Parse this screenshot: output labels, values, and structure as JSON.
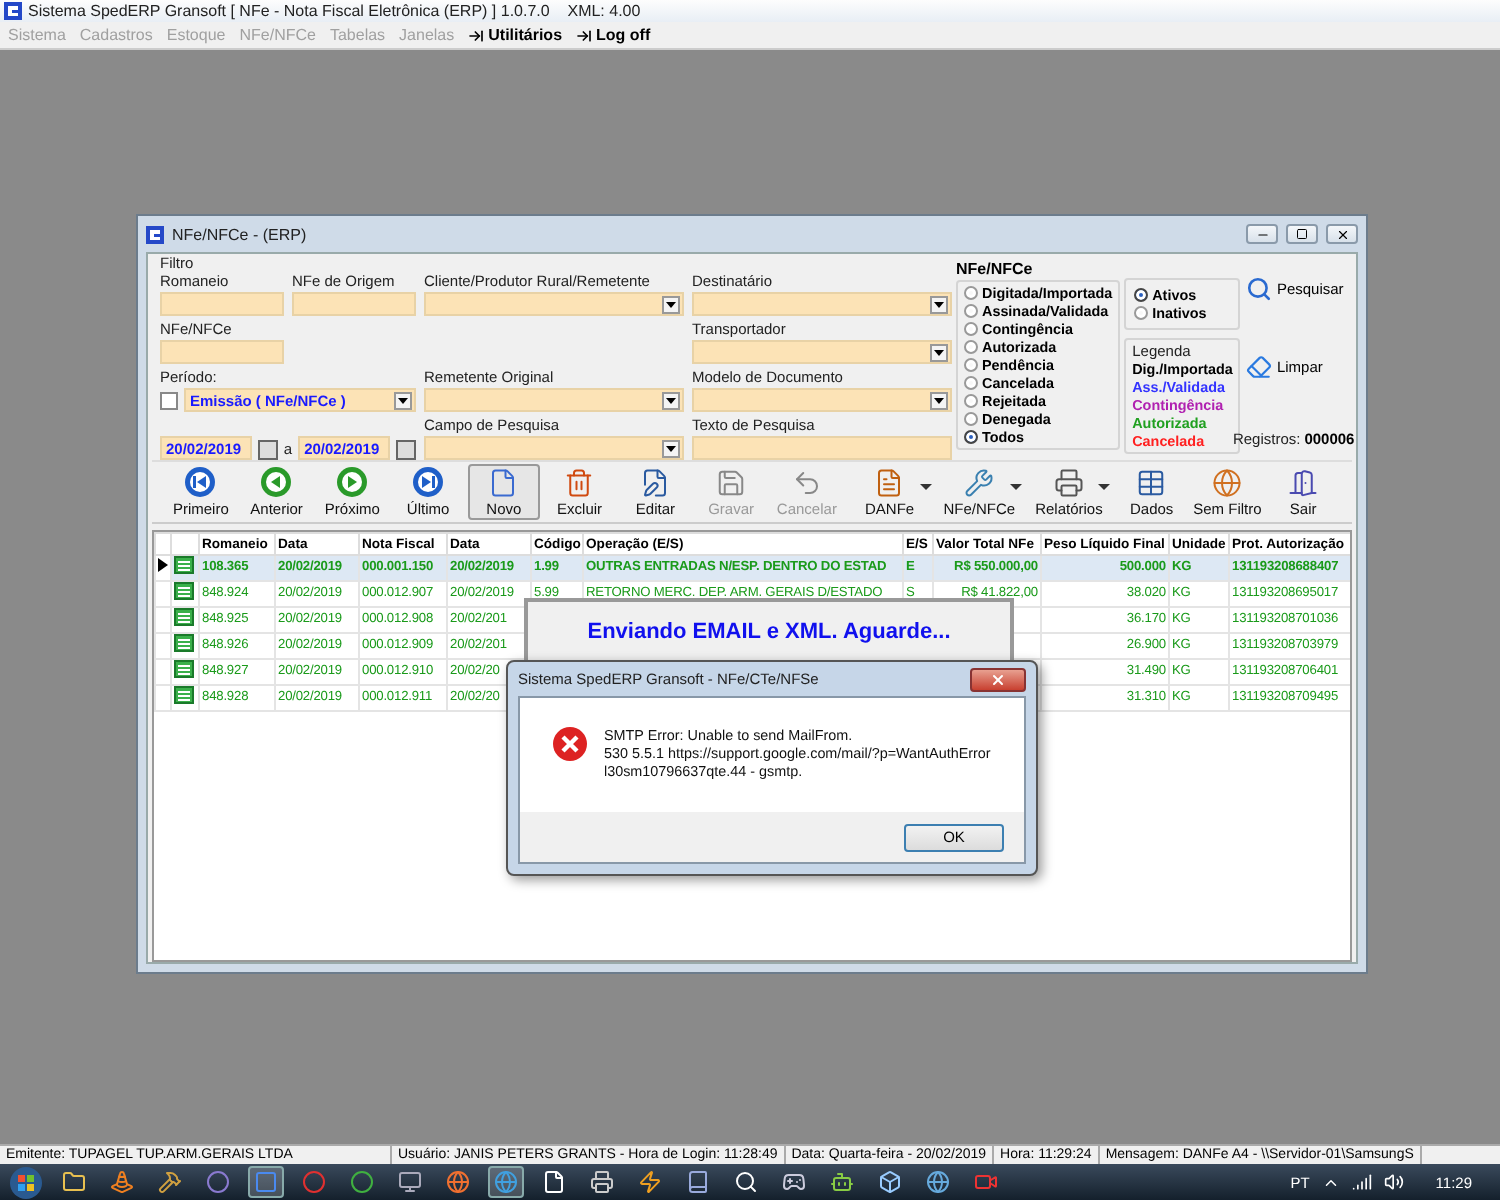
{
  "app_window": {
    "title": "Sistema SpedERP Gransoft [ NFe - Nota Fiscal Eletrônica (ERP) ] 1.0.7.0    XML: 4.00"
  },
  "menu": [
    {
      "label": "Sistema",
      "disabled": true
    },
    {
      "label": "Cadastros",
      "disabled": true
    },
    {
      "label": "Estoque",
      "disabled": true
    },
    {
      "label": "NFe/NFCe",
      "disabled": true
    },
    {
      "label": "Tabelas",
      "disabled": true
    },
    {
      "label": "Janelas",
      "disabled": true
    },
    {
      "label": "Utilitários",
      "disabled": false
    },
    {
      "label": "Log off",
      "disabled": false
    }
  ],
  "child_window": {
    "title": "NFe/NFCe - (ERP)"
  },
  "filter": {
    "title": "Filtro",
    "romaneio": {
      "label": "Romaneio"
    },
    "nfe_origem": {
      "label": "NFe de Origem"
    },
    "cliente": {
      "label": "Cliente/Produtor Rural/Remetente"
    },
    "destinatario": {
      "label": "Destinatário"
    },
    "nfe_nfce": {
      "label": "NFe/NFCe"
    },
    "transportador": {
      "label": "Transportador"
    },
    "periodo": {
      "label": "Período:",
      "checked": false,
      "value": "Emissão ( NFe/NFCe )",
      "date_from": "20/02/2019",
      "separator": "a",
      "date_to": "20/02/2019"
    },
    "remetente_original": {
      "label": "Remetente Original"
    },
    "modelo_documento": {
      "label": "Modelo de Documento"
    },
    "campo_pesquisa": {
      "label": "Campo de Pesquisa"
    },
    "texto_pesquisa": {
      "label": "Texto de Pesquisa"
    }
  },
  "status_group": {
    "title": "NFe/NFCe",
    "options": [
      {
        "label": "Digitada/Importada",
        "selected": false
      },
      {
        "label": "Assinada/Validada",
        "selected": false
      },
      {
        "label": "Contingência",
        "selected": false
      },
      {
        "label": "Autorizada",
        "selected": false
      },
      {
        "label": "Pendência",
        "selected": false
      },
      {
        "label": "Cancelada",
        "selected": false
      },
      {
        "label": "Rejeitada",
        "selected": false
      },
      {
        "label": "Denegada",
        "selected": false
      },
      {
        "label": "Todos",
        "selected": true
      }
    ]
  },
  "active_group": {
    "options": [
      {
        "label": "Ativos",
        "selected": true
      },
      {
        "label": "Inativos",
        "selected": false
      }
    ]
  },
  "legend": {
    "title": "Legenda",
    "items": [
      {
        "label": "Dig./Importada",
        "color": "#000000"
      },
      {
        "label": "Ass./Validada",
        "color": "#3333ff"
      },
      {
        "label": "Contingência",
        "color": "#b020b0"
      },
      {
        "label": "Autorizada",
        "color": "#20a020"
      },
      {
        "label": "Cancelada",
        "color": "#ff2020"
      }
    ]
  },
  "actions": [
    {
      "label": "Pesquisar"
    },
    {
      "label": "Limpar"
    }
  ],
  "registros": {
    "label": "Registros:",
    "value": "000006"
  },
  "toolbar": [
    {
      "label": "Primeiro",
      "disabled": false,
      "dropdown": false,
      "pressed": false
    },
    {
      "label": "Anterior",
      "disabled": false,
      "dropdown": false,
      "pressed": false
    },
    {
      "label": "Próximo",
      "disabled": false,
      "dropdown": false,
      "pressed": false
    },
    {
      "label": "Último",
      "disabled": false,
      "dropdown": false,
      "pressed": false
    },
    {
      "label": "Novo",
      "disabled": false,
      "dropdown": false,
      "pressed": true
    },
    {
      "label": "Excluir",
      "disabled": false,
      "dropdown": false,
      "pressed": false
    },
    {
      "label": "Editar",
      "disabled": false,
      "dropdown": false,
      "pressed": false
    },
    {
      "label": "Gravar",
      "disabled": true,
      "dropdown": false,
      "pressed": false
    },
    {
      "label": "Cancelar",
      "disabled": true,
      "dropdown": false,
      "pressed": false
    },
    {
      "label": "DANFe",
      "disabled": false,
      "dropdown": true,
      "pressed": false
    },
    {
      "label": "NFe/NFCe",
      "disabled": false,
      "dropdown": true,
      "pressed": false
    },
    {
      "label": "Relatórios",
      "disabled": false,
      "dropdown": true,
      "pressed": false
    },
    {
      "label": "Dados",
      "disabled": false,
      "dropdown": false,
      "pressed": false
    },
    {
      "label": "Sem Filtro",
      "disabled": false,
      "dropdown": false,
      "pressed": false
    },
    {
      "label": "Sair",
      "disabled": false,
      "dropdown": false,
      "pressed": false
    }
  ],
  "table": {
    "columns": [
      "Romaneio",
      "Data",
      "Nota Fiscal",
      "Data",
      "Código",
      "Operação (E/S)",
      "E/S",
      "Valor Total NFe",
      "Peso Líquido Final",
      "Unidade",
      "Prot. Autorização"
    ],
    "rows": [
      {
        "selected": true,
        "romaneio": "108.365",
        "data": "20/02/2019",
        "nota_fiscal": "000.001.150",
        "data_2": "20/02/2019",
        "codigo": "1.99",
        "operacao": "OUTRAS ENTRADAS N/ESP. DENTRO DO ESTAD",
        "es": "E",
        "valor": "R$ 550.000,00",
        "peso": "500.000",
        "unidade": "KG",
        "protocolo": "131193208688407"
      },
      {
        "selected": false,
        "romaneio": "848.924",
        "data": "20/02/2019",
        "nota_fiscal": "000.012.907",
        "data_2": "20/02/2019",
        "codigo": "5.99",
        "operacao": "RETORNO MERC. DEP. ARM. GERAIS D/ESTADO",
        "es": "S",
        "valor": "R$ 41.822,00",
        "peso": "38.020",
        "unidade": "KG",
        "protocolo": "131193208695017"
      },
      {
        "selected": false,
        "romaneio": "848.925",
        "data": "20/02/2019",
        "nota_fiscal": "000.012.908",
        "data_2": "20/02/201",
        "peso": "36.170",
        "unidade": "KG",
        "protocolo": "131193208701036"
      },
      {
        "selected": false,
        "romaneio": "848.926",
        "data": "20/02/2019",
        "nota_fiscal": "000.012.909",
        "data_2": "20/02/201",
        "peso": "26.900",
        "unidade": "KG",
        "protocolo": "131193208703979"
      },
      {
        "selected": false,
        "romaneio": "848.927",
        "data": "20/02/2019",
        "nota_fiscal": "000.012.910",
        "data_2": "20/02/20",
        "peso": "31.490",
        "unidade": "KG",
        "protocolo": "131193208706401"
      },
      {
        "selected": false,
        "romaneio": "848.928",
        "data": "20/02/2019",
        "nota_fiscal": "000.012.911",
        "data_2": "20/02/20",
        "peso": "31.310",
        "unidade": "KG",
        "protocolo": "131193208709495"
      }
    ]
  },
  "progress_panel": {
    "text": "Enviando EMAIL e XML. Aguarde..."
  },
  "message_box": {
    "title": "Sistema SpedERP Gransoft - NFe/CTe/NFSe",
    "lines": [
      "SMTP Error: Unable to send MailFrom.",
      "530 5.5.1  https://support.google.com/mail/?p=WantAuthError",
      "l30sm10796637qte.44 - gsmtp."
    ],
    "button": "OK"
  },
  "status_bar": [
    "Emitente: TUPAGEL TUP.ARM.GERAIS LTDA",
    "Usuário: JANIS PETERS GRANTS - Hora de Login: 11:28:49",
    "Data: Quarta-feira - 20/02/2019",
    "Hora: 11:29:24",
    "Mensagem: DANFe A4 - \\\\Servidor-01\\SamsungS"
  ],
  "taskbar": {
    "language": "PT",
    "clock": "11:29"
  }
}
